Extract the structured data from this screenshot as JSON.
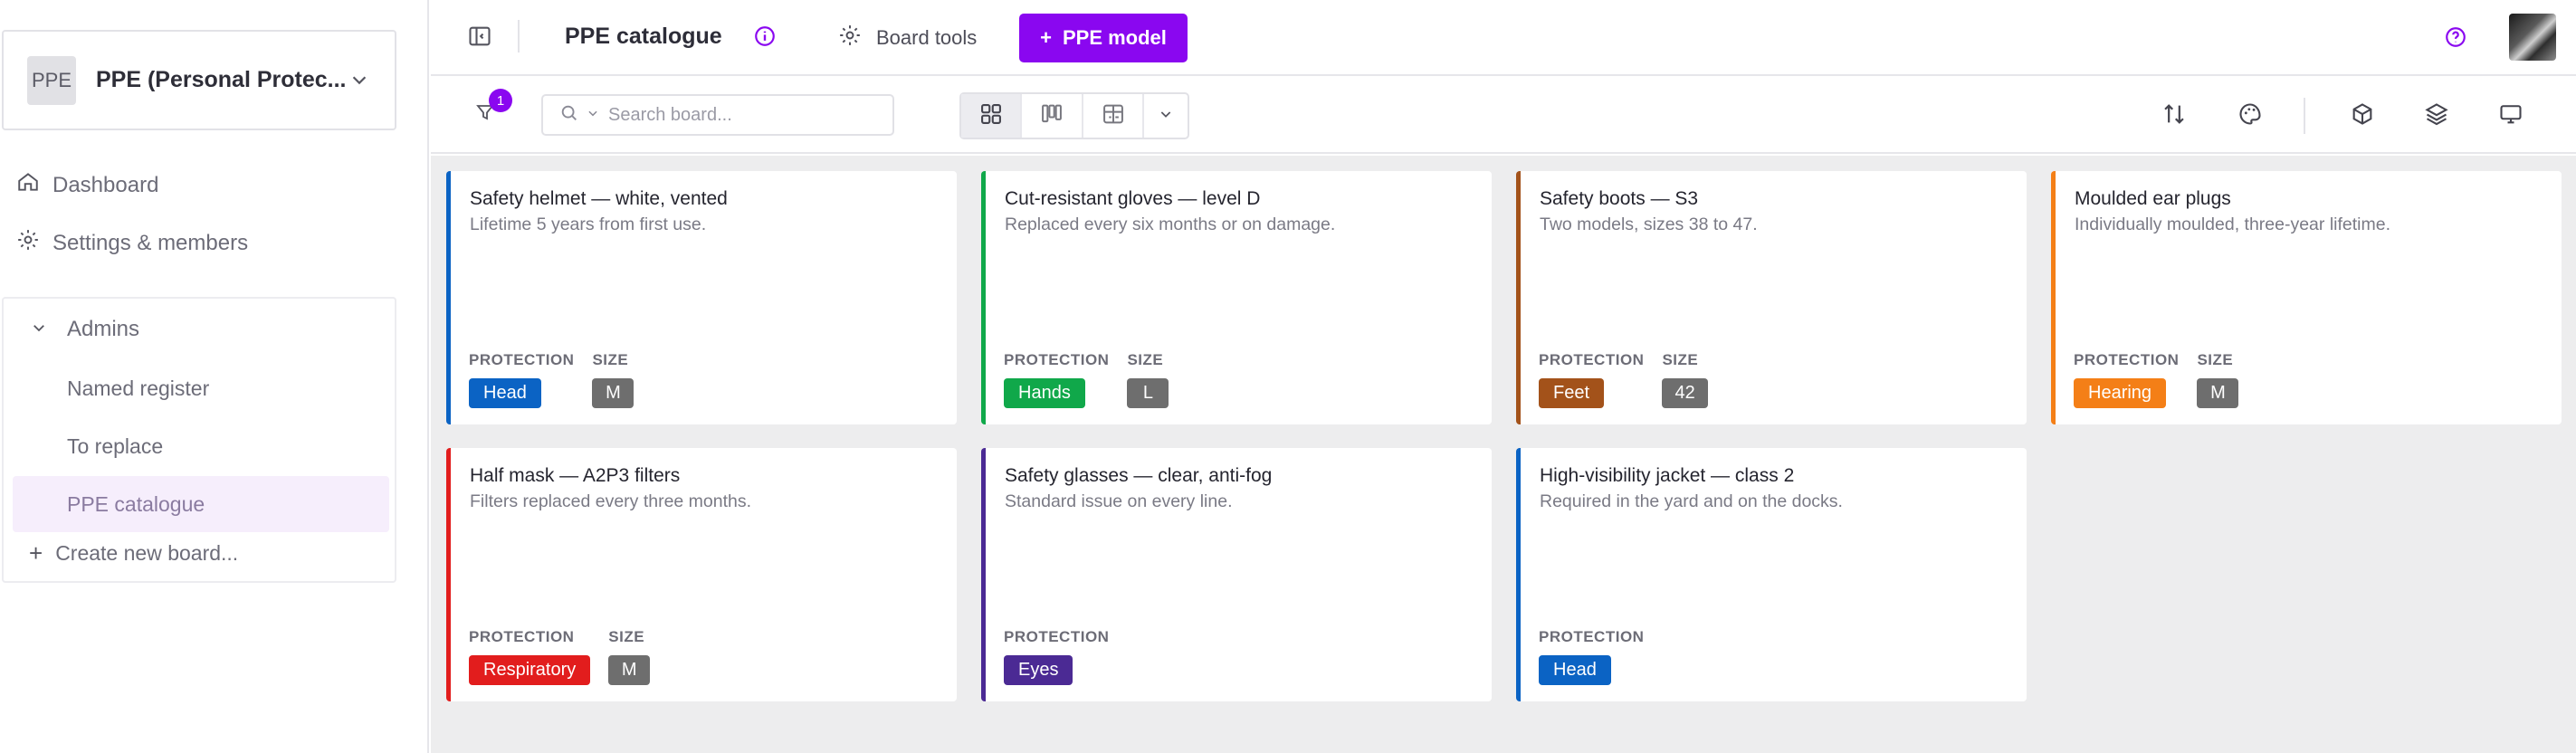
{
  "workspace": {
    "badge": "PPE",
    "name": "PPE (Personal Protec..."
  },
  "sidebar": {
    "nav": [
      {
        "label": "Dashboard",
        "icon": "home-icon"
      },
      {
        "label": "Settings & members",
        "icon": "gear-icon"
      }
    ],
    "group": {
      "label": "Admins",
      "boards": [
        "Named register",
        "To replace",
        "PPE catalogue"
      ],
      "active_board": "PPE catalogue"
    },
    "create_board": "Create new board..."
  },
  "topbar": {
    "title": "PPE catalogue",
    "board_tools": "Board tools",
    "primary_button": "PPE model"
  },
  "toolbar": {
    "filter_count": "1",
    "search_placeholder": "Search board..."
  },
  "cards": [
    {
      "title": "Safety helmet — white, vented",
      "description": "Lifetime 5 years from first use.",
      "protection": "Head",
      "size": "M",
      "color": "#0b63c4"
    },
    {
      "title": "Cut-resistant gloves — level D",
      "description": "Replaced every six months or on damage.",
      "protection": "Hands",
      "size": "L",
      "color": "#10a84a"
    },
    {
      "title": "Safety boots — S3",
      "description": "Two models, sizes 38 to 47.",
      "protection": "Feet",
      "size": "42",
      "color": "#a3521a"
    },
    {
      "title": "Moulded ear plugs",
      "description": "Individually moulded, three-year lifetime.",
      "protection": "Hearing",
      "size": "M",
      "color": "#f47f17"
    },
    {
      "title": "Half mask — A2P3 filters",
      "description": "Filters replaced every three months.",
      "protection": "Respiratory",
      "size": "M",
      "color": "#e21d1d"
    },
    {
      "title": "Safety glasses — clear, anti-fog",
      "description": "Standard issue on every line.",
      "protection": "Eyes",
      "size": null,
      "color": "#4b2a94"
    },
    {
      "title": "High-visibility jacket — class 2",
      "description": "Required in the yard and on the docks.",
      "protection": "Head",
      "size": null,
      "color": "#0b63c4"
    }
  ],
  "field_labels": {
    "protection": "PROTECTION",
    "size": "SIZE"
  },
  "colors": {
    "accent": "#8a07f0"
  }
}
